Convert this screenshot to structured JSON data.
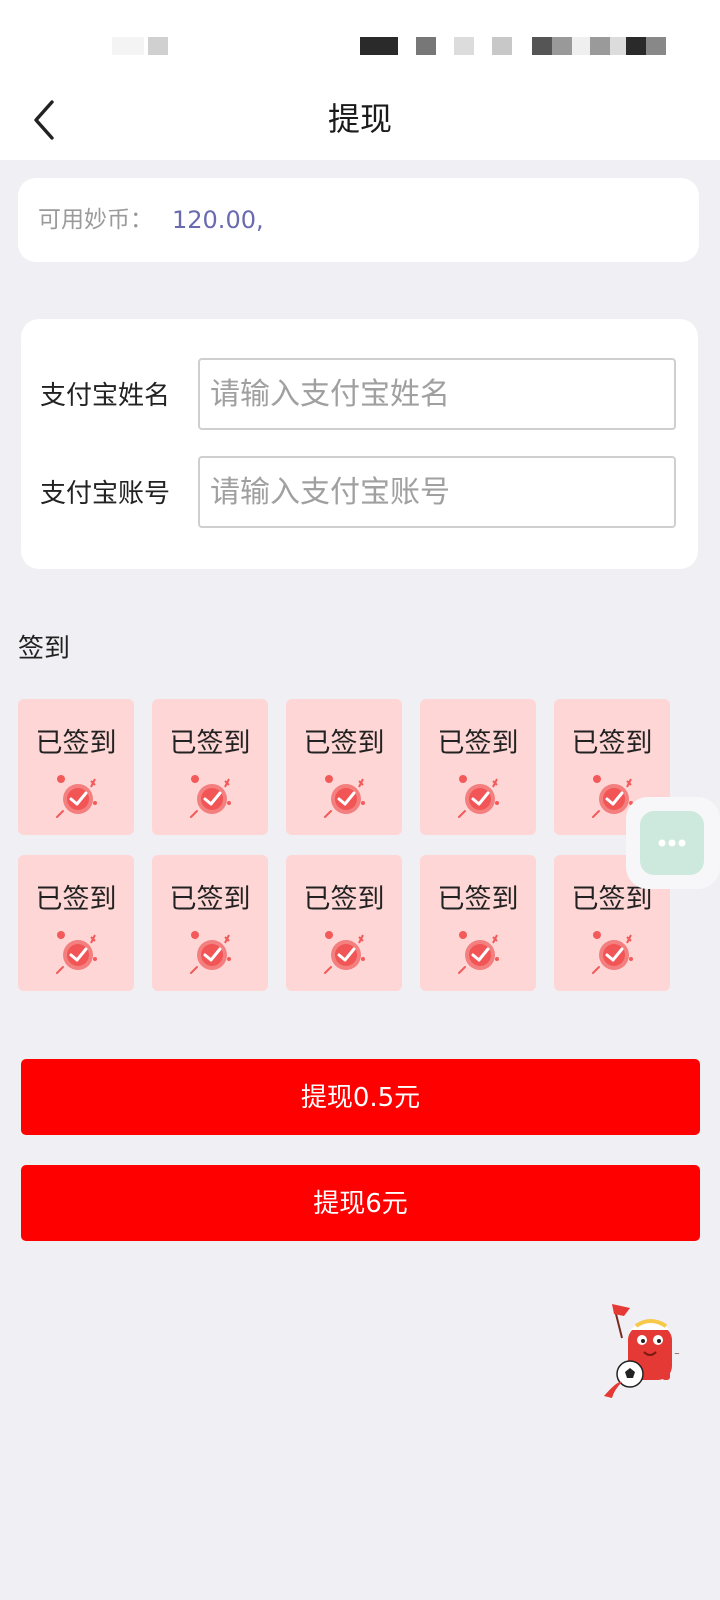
{
  "header": {
    "title": "提现"
  },
  "balance": {
    "label": "可用妙币：",
    "value": "120.00,"
  },
  "form": {
    "name_label": "支付宝姓名",
    "name_placeholder": "请输入支付宝姓名",
    "account_label": "支付宝账号",
    "account_placeholder": "请输入支付宝账号"
  },
  "signin": {
    "title": "签到",
    "days": [
      {
        "label": "已签到"
      },
      {
        "label": "已签到"
      },
      {
        "label": "已签到"
      },
      {
        "label": "已签到"
      },
      {
        "label": "已签到"
      },
      {
        "label": "已签到"
      },
      {
        "label": "已签到"
      },
      {
        "label": "已签到"
      },
      {
        "label": "已签到"
      },
      {
        "label": "已签到"
      }
    ]
  },
  "actions": {
    "withdraw_small": "提现0.5元",
    "withdraw_large": "提现6元"
  },
  "colors": {
    "accent": "#ff0000",
    "signin_bg": "#ffd6d6",
    "page_bg": "#efeff4",
    "balance_value": "#6a6ab0"
  },
  "icons": {
    "back": "chevron-left-icon",
    "signin": "checkmark-badge-icon",
    "floating": "more-dots-icon",
    "mascot": "soccer-mascot-icon"
  }
}
